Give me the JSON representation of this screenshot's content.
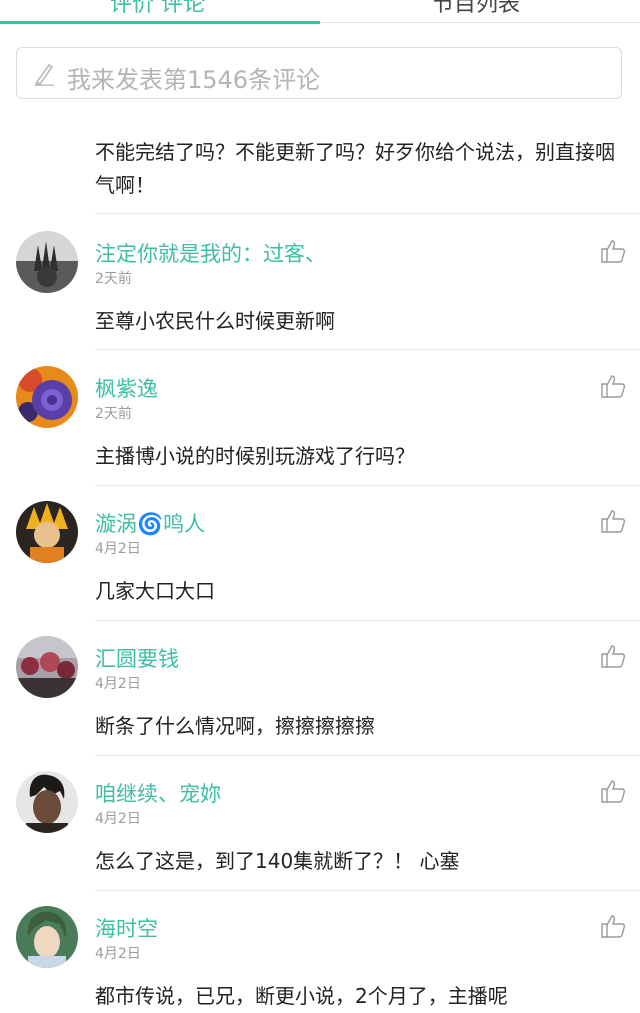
{
  "tabs": [
    {
      "label": "评价 评论"
    },
    {
      "label": "节目列表"
    }
  ],
  "compose": {
    "placeholder": "我来发表第1546条评论",
    "icon": "pencil-icon"
  },
  "colors": {
    "accent": "#3dbfa5",
    "divider": "#e9e9e9",
    "muted": "#9c9c9c"
  },
  "comments": [
    {
      "text": "不能完结了吗？不能更新了吗？好歹你给个说法，别直接咽气啊！"
    },
    {
      "user": "注定你就是我的：过客、",
      "time": "2天前",
      "text": "至尊小农民什么时候更新啊"
    },
    {
      "user": "枫紫逸",
      "time": "2天前",
      "text": "主播博小说的时候别玩游戏了行吗？"
    },
    {
      "user": "漩涡🌀鸣人",
      "time": "4月2日",
      "text": "几家大口大口"
    },
    {
      "user": "汇圆要钱",
      "time": "4月2日",
      "text": "断条了什么情况啊，擦擦擦擦擦"
    },
    {
      "user": "咱继续、宠妳",
      "time": "4月2日",
      "text": "怎么了这是，到了140集就断了？！ 心塞"
    },
    {
      "user": "海时空",
      "time": "4月2日",
      "text": "都市传说，已兄，断更小说，2个月了，主播呢"
    }
  ]
}
